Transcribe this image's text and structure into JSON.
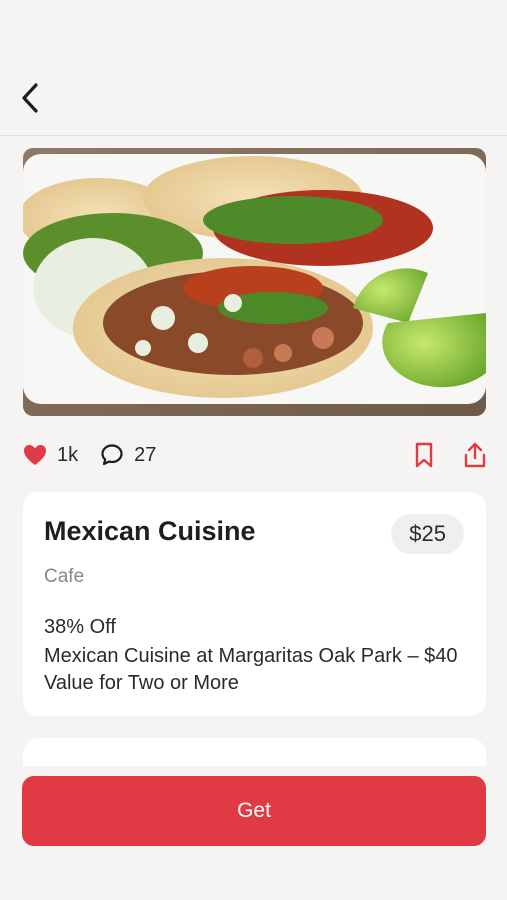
{
  "header": {
    "back_icon": "chevron-left-icon"
  },
  "hero": {
    "image_icon": "food-photo-tacos"
  },
  "social": {
    "likes": "1k",
    "comments": "27",
    "like_icon": "heart-icon",
    "comment_icon": "comment-icon",
    "bookmark_icon": "bookmark-icon",
    "share_icon": "share-icon",
    "accent_color": "#e03a45"
  },
  "deal": {
    "title": "Mexican Cuisine",
    "price": "$25",
    "category": "Cafe",
    "discount": "38% Off",
    "description": "Mexican Cuisine at Margaritas Oak Park – $40 Value for Two or More"
  },
  "cta": {
    "label": "Get",
    "color": "#e03a45"
  }
}
